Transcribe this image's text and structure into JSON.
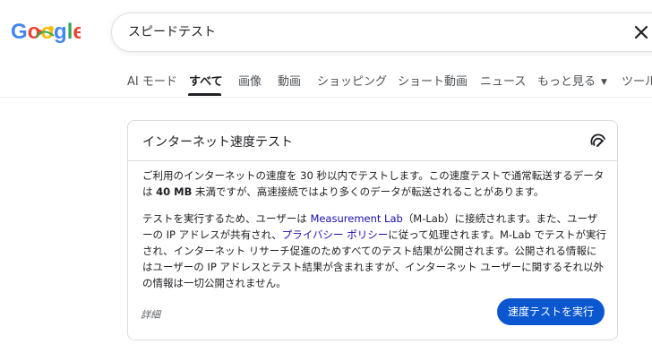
{
  "logo": {
    "text": "Google"
  },
  "search": {
    "value": "スピードテスト"
  },
  "tabs": [
    {
      "label": "AI モード"
    },
    {
      "label": "すべて"
    },
    {
      "label": "画像"
    },
    {
      "label": "動画"
    },
    {
      "label": "ショッピング"
    },
    {
      "label": "ショート動画"
    },
    {
      "label": "ニュース"
    },
    {
      "label": "もっと見る"
    },
    {
      "label": "ツール"
    }
  ],
  "card": {
    "title": "インターネット速度テスト",
    "para1": {
      "t1": "ご利用のインターネットの速度を 30 秒以内でテストします。この速度テストで通常転送するデータは ",
      "bold": "40 MB",
      "t2": " 未満ですが、高速接続ではより多くのデータが転送されることがあります。"
    },
    "para2": {
      "t1": "テストを実行するため、ユーザーは ",
      "link1": "Measurement Lab",
      "t2": "（M-Lab）に接続されます。また、ユーザーの IP アドレスが共有され、",
      "link2": "プライバシー ポリシー",
      "t3": "に従って処理されます。M-Lab でテストが実行され、インターネット リサーチ促進のためすべてのテスト結果が公開されます。公開される情報にはユーザーの IP アドレスとテスト結果が含まれますが、インターネット ユーザーに関するそれ以外の情報は一切公開されません。"
    },
    "details_label": "詳細",
    "run_button_label": "速度テストを実行"
  },
  "colors": {
    "accent": "#0b57d0",
    "link": "#1a0dab",
    "google_blue": "#4285f4",
    "google_red": "#ea4335",
    "google_yellow": "#fbbc05",
    "google_green": "#34a853"
  }
}
